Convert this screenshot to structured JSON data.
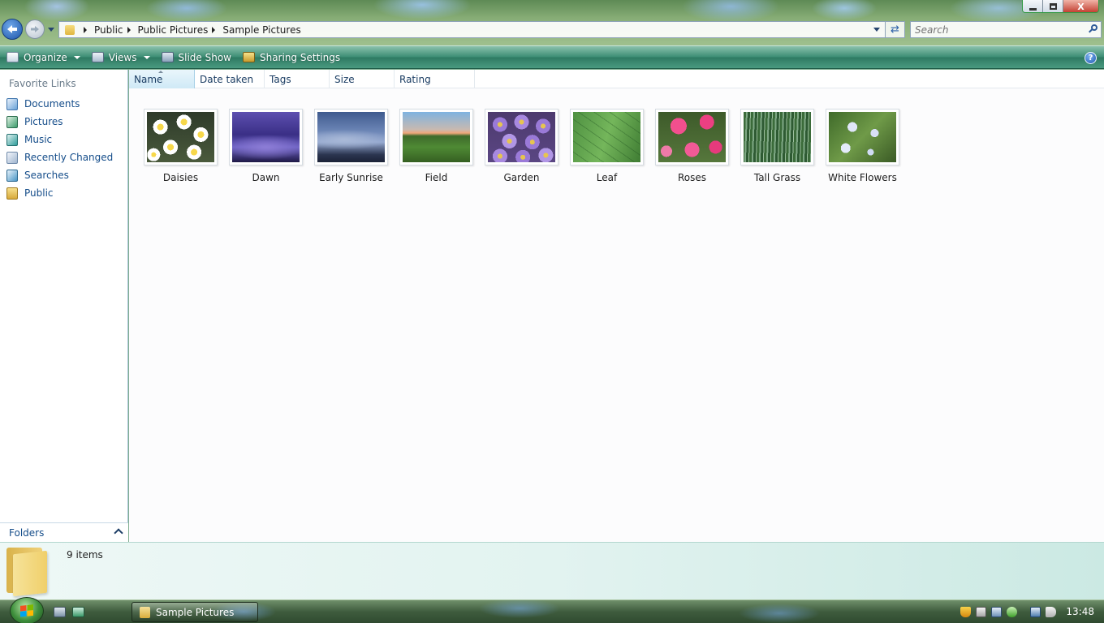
{
  "window": {
    "address": {
      "crumbs": [
        "Public",
        "Public Pictures",
        "Sample Pictures"
      ]
    },
    "search": {
      "placeholder": "Search"
    },
    "controls": {
      "close_label": "X"
    }
  },
  "toolbar": {
    "organize_label": "Organize",
    "views_label": "Views",
    "slideshow_label": "Slide Show",
    "sharing_label": "Sharing Settings",
    "help_label": "?"
  },
  "nav": {
    "title": "Favorite Links",
    "items": [
      {
        "label": "Documents",
        "icon": "documents-icon"
      },
      {
        "label": "Pictures",
        "icon": "pictures-icon"
      },
      {
        "label": "Music",
        "icon": "music-icon"
      },
      {
        "label": "Recently Changed",
        "icon": "recently-changed-icon"
      },
      {
        "label": "Searches",
        "icon": "searches-icon"
      },
      {
        "label": "Public",
        "icon": "folder-icon"
      }
    ],
    "folders_label": "Folders"
  },
  "columns": [
    "Name",
    "Date taken",
    "Tags",
    "Size",
    "Rating"
  ],
  "files": [
    {
      "name": "Daisies"
    },
    {
      "name": "Dawn"
    },
    {
      "name": "Early Sunrise"
    },
    {
      "name": "Field"
    },
    {
      "name": "Garden"
    },
    {
      "name": "Leaf"
    },
    {
      "name": "Roses"
    },
    {
      "name": "Tall Grass"
    },
    {
      "name": "White Flowers"
    }
  ],
  "details": {
    "item_count": "9 items"
  },
  "taskbar": {
    "active_window": "Sample Pictures",
    "clock": "13:48"
  },
  "colors": {
    "toolbar": "#3e8f76",
    "link": "#154d8a",
    "details_pane": "#e2f3f0"
  }
}
